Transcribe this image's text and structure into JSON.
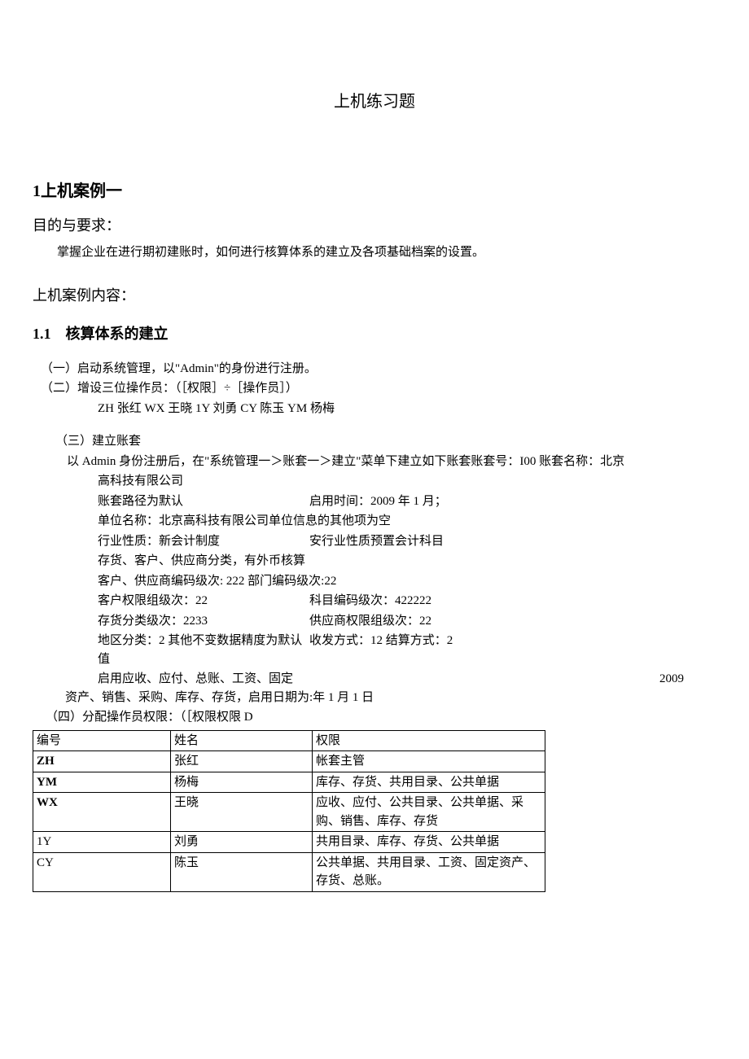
{
  "title": "上机练习题",
  "case1_heading": "1上机案例一",
  "purpose_heading": "目的与要求：",
  "purpose_body": "掌握企业在进行期初建账时，如何进行核算体系的建立及各项基础档案的设置。",
  "content_heading": "上机案例内容：",
  "section11_heading": "1.1　核算体系的建立",
  "step1": "（一）启动系统管理，以\"Admin\"的身份进行注册。",
  "step2": "（二）增设三位操作员：（［权限］÷［操作员］）",
  "step2_sub": "ZH 张红 WX 王晓 1Y 刘勇 CY 陈玉 YM 杨梅",
  "step3": "（三）建立账套",
  "step3_intro": "以 Admin 身份注册后，在\"系统管理一＞账套一＞建立\"菜单下建立如下账套账套号：I00  账套名称：北京",
  "d_a": "高科技有限公司",
  "d_b1": "账套路径为默认",
  "d_b2": "启用时间：2009 年 1 月；",
  "d_c": "单位名称：北京高科技有限公司单位信息的其他项为空",
  "d_d1": "行业性质：新会计制度",
  "d_d2": "安行业性质预置会计科目",
  "d_e": "存货、客户、供应商分类，有外币核算",
  "d_f": "客户、供应商编码级次: 222 部门编码级次:22",
  "d_g1": "客户权限组级次：22",
  "d_g2": "科目编码级次：422222",
  "d_h1": "存货分类级次：2233",
  "d_h2": "供应商权限组级次：22",
  "d_i1": "地区分类：2 其他不变数据精度为默认值",
  "d_i2": "收发方式：12 结算方式：2",
  "wrap_a": "启用应收、应付、总账、工资、固定",
  "wrap_year": "2009",
  "wrap_b": "资产、销售、采购、库存、存货，启用日期为:年 1 月 1 日",
  "step4": "（四）分配操作员权限：（［权限权限 D",
  "perm": {
    "head": {
      "c0": "编号",
      "c1": "姓名",
      "c2": "权限"
    },
    "rows": [
      {
        "c0": "ZH",
        "c1": "张红",
        "c2": "帐套主管",
        "bold": true
      },
      {
        "c0": "YM",
        "c1": "杨梅",
        "c2": "库存、存货、共用目录、公共单据",
        "bold": true
      },
      {
        "c0": "WX",
        "c1": "王晓",
        "c2": "应收、应付、公共目录、公共单据、采购、销售、库存、存货",
        "bold": true
      },
      {
        "c0": "1Y",
        "c1": "刘勇",
        "c2": "共用目录、库存、存货、公共单据",
        "bold": false
      },
      {
        "c0": "CY",
        "c1": "陈玉",
        "c2": "公共单据、共用目录、工资、固定资产、存货、总账。",
        "bold": false
      }
    ]
  }
}
